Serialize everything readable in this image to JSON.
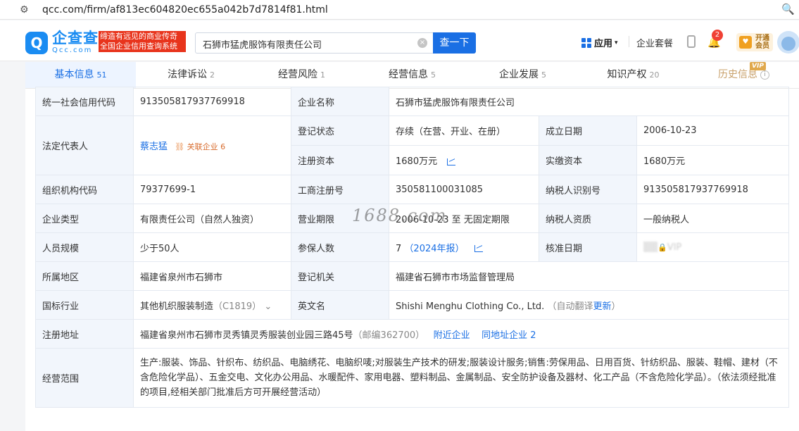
{
  "browser": {
    "url": "qcc.com/firm/af813ec604820ec655a042b7d7814f81.html"
  },
  "header": {
    "logo_cn": "企查查",
    "logo_en": "Qcc.com",
    "slogan_line1": "缔造有远见的商业传奇",
    "slogan_line2": "全国企业信用查询系统",
    "search_value": "石狮市猛虎服饰有限责任公司",
    "search_button": "查一下",
    "apps_label": "应用",
    "package_label": "企业套餐",
    "notify_count": "2",
    "vip_line1": "开通",
    "vip_line2": "会员"
  },
  "tabs": [
    {
      "label": "基本信息",
      "count": "51"
    },
    {
      "label": "法律诉讼",
      "count": "2"
    },
    {
      "label": "经营风险",
      "count": "1"
    },
    {
      "label": "经营信息",
      "count": "5"
    },
    {
      "label": "企业发展",
      "count": "5"
    },
    {
      "label": "知识产权",
      "count": "20"
    },
    {
      "label": "历史信息",
      "count": ""
    }
  ],
  "vip_tag": "VIP",
  "info": {
    "credit_code_label": "统一社会信用代码",
    "credit_code": "913505817937769918",
    "company_name_label": "企业名称",
    "company_name": "石狮市猛虎服饰有限责任公司",
    "legal_rep_label": "法定代表人",
    "legal_rep": "蔡志猛",
    "related_label": "关联企业",
    "related_count": "6",
    "reg_status_label": "登记状态",
    "reg_status": "存续（在营、开业、在册）",
    "founded_label": "成立日期",
    "founded": "2006-10-23",
    "reg_capital_label": "注册资本",
    "reg_capital": "1680万元",
    "paid_capital_label": "实缴资本",
    "paid_capital": "1680万元",
    "org_code_label": "组织机构代码",
    "org_code": "79377699-1",
    "biz_reg_no_label": "工商注册号",
    "biz_reg_no": "350581100031085",
    "taxpayer_id_label": "纳税人识别号",
    "taxpayer_id": "913505817937769918",
    "company_type_label": "企业类型",
    "company_type": "有限责任公司（自然人独资）",
    "term_label": "营业期限",
    "term": "2006-10-23 至 无固定期限",
    "taxpayer_qual_label": "纳税人资质",
    "taxpayer_qual": "一般纳税人",
    "staff_size_label": "人员规模",
    "staff_size": "少于50人",
    "insured_label": "参保人数",
    "insured": "7",
    "insured_year": "（2024年报）",
    "approved_label": "核准日期",
    "approved_locked": "VIP",
    "region_label": "所属地区",
    "region": "福建省泉州市石狮市",
    "authority_label": "登记机关",
    "authority": "福建省石狮市市场监督管理局",
    "industry_label": "国标行业",
    "industry": "其他机织服装制造",
    "industry_code": "（C1819）",
    "english_name_label": "英文名",
    "english_name": "Shishi Menghu Clothing Co., Ltd.",
    "auto_translate": "（自动翻译",
    "update": "更新",
    "close_paren": "）",
    "address_label": "注册地址",
    "address": "福建省泉州市石狮市灵秀镇灵秀服装创业园三路45号",
    "postcode": "（邮编362700）",
    "nearby": "附近企业",
    "same_address": "同地址企业",
    "same_address_count": "2",
    "scope_label": "经营范围",
    "scope": "生产:服装、饰品、针织布、纺织品、电脑绣花、电脑织唛;对服装生产技术的研发;服装设计服务;销售:劳保用品、日用百货、针纺织品、服装、鞋帽、建材（不含危险化学品）、五金交电、文化办公用品、水暖配件、家用电器、塑料制品、金属制品、安全防护设备及器材、化工产品（不含危险化学品）。（依法须经批准的项目,经相关部门批准后方可开展经营活动）"
  },
  "watermark": "1688.com",
  "colors": {
    "brand_blue": "#1a6fe4",
    "label_bg": "#f2f6fc",
    "slogan_red": "#e8341c"
  }
}
